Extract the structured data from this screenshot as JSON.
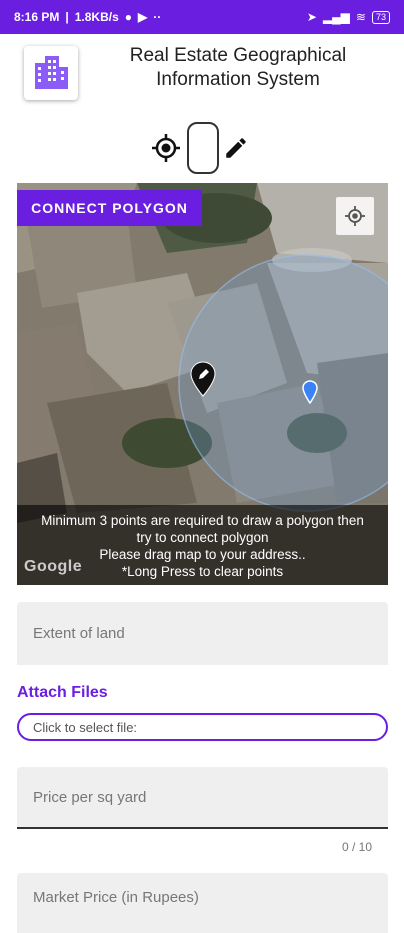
{
  "status_bar": {
    "time": "8:16 PM",
    "speed": "1.8KB/s",
    "battery": "73"
  },
  "header": {
    "title_line1": "Real Estate Geographical",
    "title_line2": "Information System"
  },
  "map": {
    "connect_button": "CONNECT POLYGON",
    "overlay_line1": "Minimum 3 points are required to draw a polygon then",
    "overlay_line2": "try to connect polygon",
    "overlay_line3": "Please drag map to your address..",
    "overlay_line4": "*Long Press to clear points",
    "google_logo": "Google"
  },
  "form": {
    "extent_placeholder": "Extent of land",
    "attach_label": "Attach Files",
    "file_select_text": "Click to select file:",
    "price_placeholder": "Price per sq yard",
    "price_counter": "0 / 10",
    "market_price_placeholder": "Market Price (in Rupees)"
  },
  "colors": {
    "accent": "#6a1fe0",
    "field_bg": "#efefef"
  },
  "icons": [
    "location-icon",
    "youtube-icon",
    "wifi-icon",
    "signal-icon",
    "gps-icon",
    "pencil-icon",
    "my-location-icon",
    "map-marker-icon",
    "building-icon"
  ]
}
